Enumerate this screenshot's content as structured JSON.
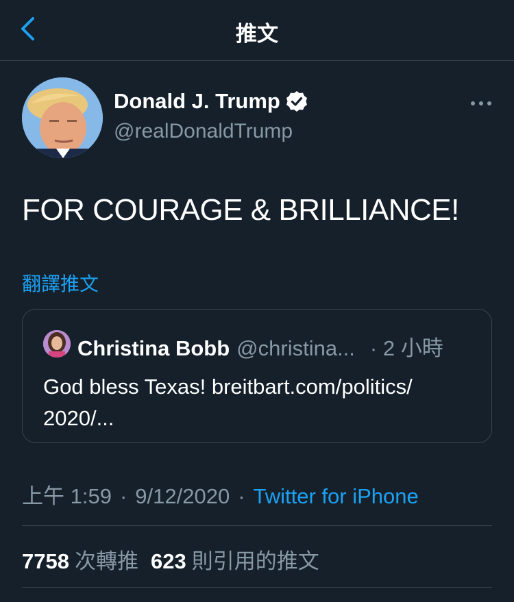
{
  "header": {
    "title": "推文",
    "back_icon": "chevron-left-icon"
  },
  "author": {
    "name": "Donald J. Trump",
    "handle": "@realDonaldTrump",
    "verified_icon": "verified-badge-icon",
    "more_icon": "more-horizontal-icon"
  },
  "tweet": {
    "text": "FOR COURAGE & BRILLIANCE!",
    "translate_label": "翻譯推文"
  },
  "quote": {
    "name": "Christina Bobb",
    "handle": "@christina...",
    "time": "· 2 小時",
    "text": "God bless Texas! breitbart.com/politics/ 2020/..."
  },
  "meta": {
    "time": "上午 1:59",
    "separator": "·",
    "date": "9/12/2020",
    "source": "Twitter for iPhone"
  },
  "stats": {
    "retweets_count": "7758",
    "retweets_label": "次轉推",
    "quotes_count": "623",
    "quotes_label": "則引用的推文"
  },
  "colors": {
    "background": "#15202b",
    "accent": "#1da1f2",
    "secondary_text": "#8899a6",
    "border": "#38444d"
  }
}
